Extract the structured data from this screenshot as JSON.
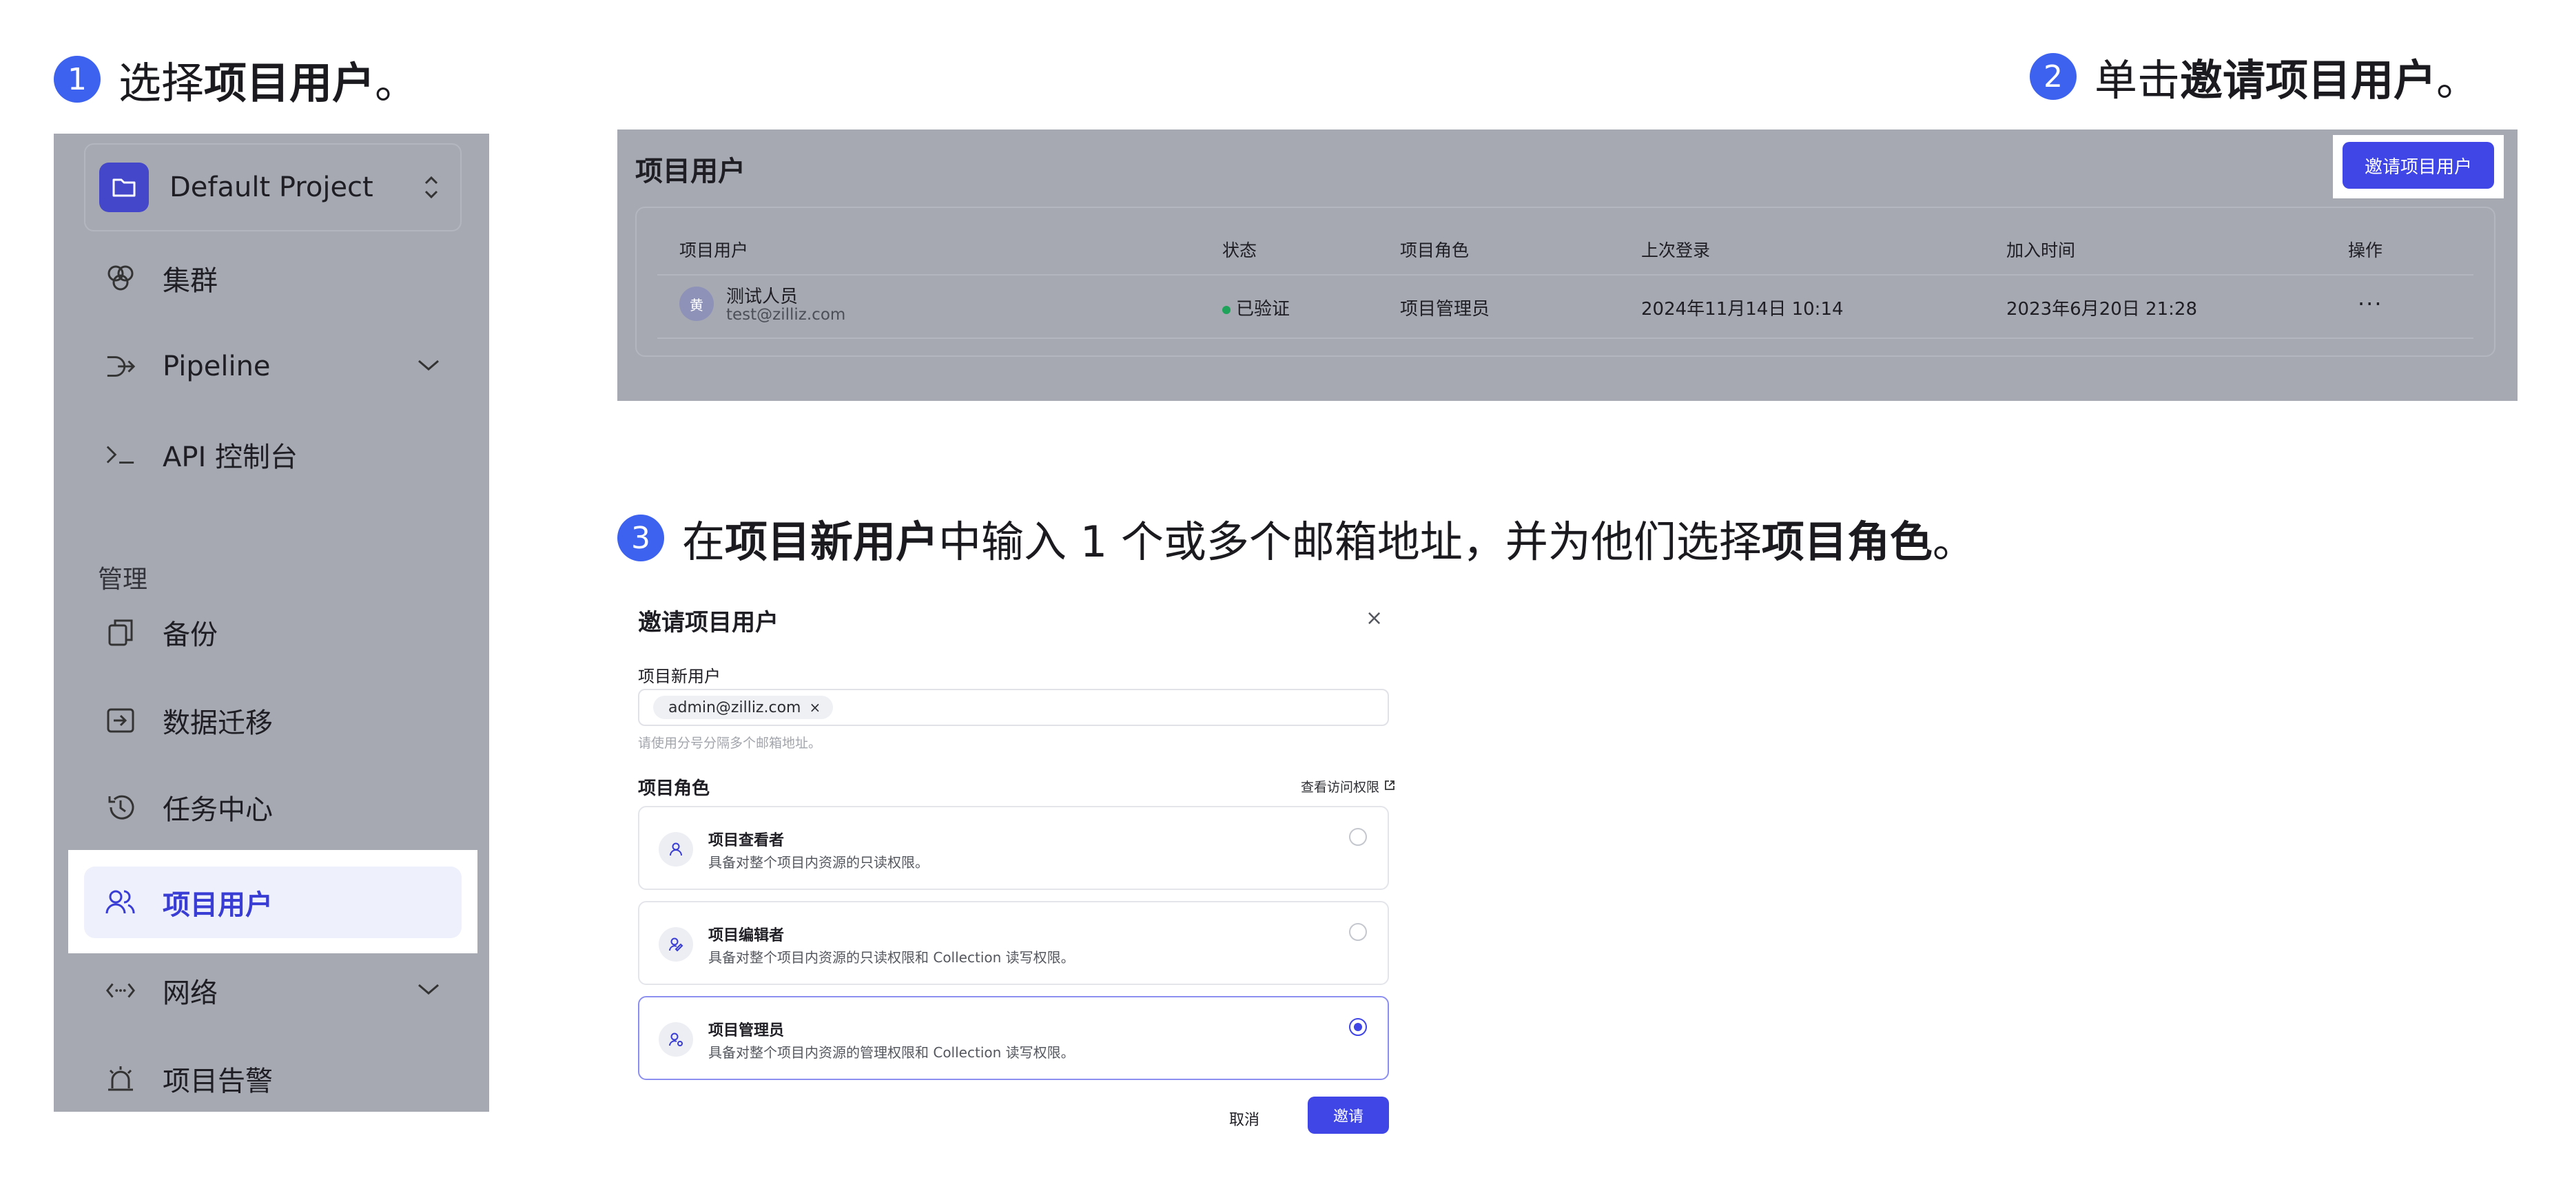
{
  "steps": [
    {
      "num": "1",
      "pre": "选择",
      "bold": "项目用户",
      "post": "。"
    },
    {
      "num": "2",
      "pre": "单击",
      "bold": "邀请项目用户",
      "post": "。"
    },
    {
      "num": "3",
      "pre": "在",
      "bold": "项目新用户",
      "mid": "中输入 1 个或多个邮箱地址，并为他们选择",
      "bold2": "项目角色",
      "post": "。"
    }
  ],
  "sidebar": {
    "project_name": "Default Project",
    "section_label": "管理",
    "items": [
      {
        "label": "集群",
        "icon": "cluster-icon"
      },
      {
        "label": "Pipeline",
        "icon": "pipeline-icon"
      },
      {
        "label": "API 控制台",
        "icon": "terminal-icon"
      },
      {
        "label": "备份",
        "icon": "backup-icon"
      },
      {
        "label": "数据迁移",
        "icon": "migration-icon"
      },
      {
        "label": "任务中心",
        "icon": "history-icon"
      },
      {
        "label": "项目用户",
        "icon": "users-icon",
        "active": true
      },
      {
        "label": "网络",
        "icon": "network-icon"
      },
      {
        "label": "项目告警",
        "icon": "alarm-icon"
      }
    ]
  },
  "users_panel": {
    "title": "项目用户",
    "invite_button": "邀请项目用户",
    "columns": [
      "项目用户",
      "状态",
      "项目角色",
      "上次登录",
      "加入时间",
      "操作"
    ],
    "rows": [
      {
        "avatar": "黄",
        "name": "测试人员",
        "email": "test@zilliz.com",
        "status": "已验证",
        "role": "项目管理员",
        "last_login": "2024年11月14日 10:14",
        "joined": "2023年6月20日 21:28",
        "action": "···"
      }
    ]
  },
  "dialog": {
    "title": "邀请项目用户",
    "close": "×",
    "new_users_label": "项目新用户",
    "email_chip": "admin@zilliz.com",
    "chip_remove": "×",
    "hint": "请使用分号分隔多个邮箱地址。",
    "role_label": "项目角色",
    "permissions_link": "查看访问权限",
    "roles": [
      {
        "name": "项目查看者",
        "desc": "具备对整个项目内资源的只读权限。",
        "selected": false
      },
      {
        "name": "项目编辑者",
        "desc": "具备对整个项目内资源的只读权限和 Collection 读写权限。",
        "selected": false
      },
      {
        "name": "项目管理员",
        "desc": "具备对整个项目内资源的管理权限和 Collection 读写权限。",
        "selected": true
      }
    ],
    "cancel": "取消",
    "submit": "邀请"
  },
  "colors": {
    "accent": "#4045e6",
    "step_badge": "#3d62f0",
    "overlay": "#a6a9b2",
    "status_green": "#1fa35a"
  }
}
